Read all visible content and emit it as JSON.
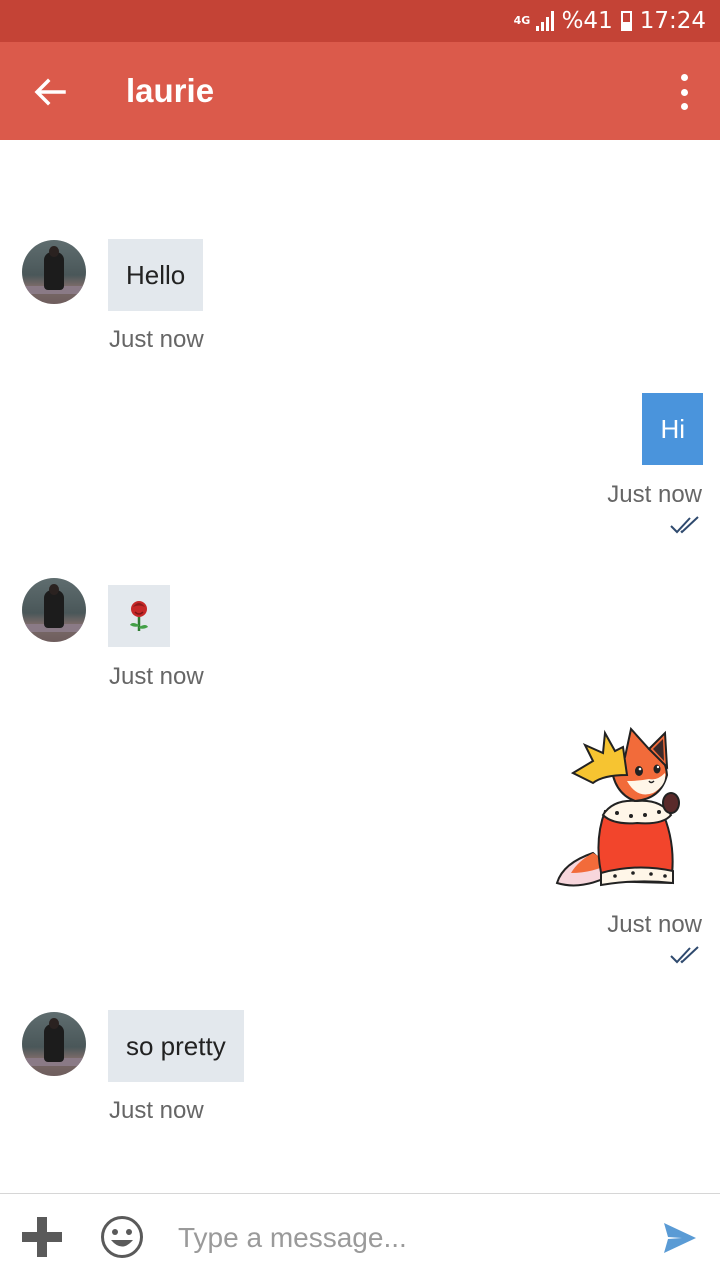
{
  "status_bar": {
    "network": "4G",
    "battery_text": "%41",
    "battery_level": 0.41,
    "time": "17:24"
  },
  "header": {
    "back_icon": "arrow-left-icon",
    "title": "laurie",
    "menu_icon": "more-vertical-icon"
  },
  "messages": [
    {
      "direction": "incoming",
      "type": "text",
      "text": "Hello",
      "timestamp": "Just now"
    },
    {
      "direction": "outgoing",
      "type": "text",
      "text": "Hi",
      "timestamp": "Just now",
      "status_icon": "double-check-icon"
    },
    {
      "direction": "incoming",
      "type": "emoji",
      "emoji": "🌹",
      "timestamp": "Just now"
    },
    {
      "direction": "outgoing",
      "type": "sticker",
      "sticker": "fox-king-sticker",
      "timestamp": "Just now",
      "status_icon": "double-check-icon"
    },
    {
      "direction": "incoming",
      "type": "text",
      "text": "so pretty",
      "timestamp": "Just now"
    }
  ],
  "composer": {
    "attach_icon": "plus-icon",
    "emoji_icon": "smiley-icon",
    "placeholder": "Type a message...",
    "value": "",
    "send_icon": "send-icon"
  },
  "colors": {
    "status_bar": "#c44336",
    "app_bar": "#db5a4b",
    "incoming_bubble": "#e3e8ed",
    "outgoing_bubble": "#4a94dc",
    "send_icon": "#5a9bd5"
  }
}
